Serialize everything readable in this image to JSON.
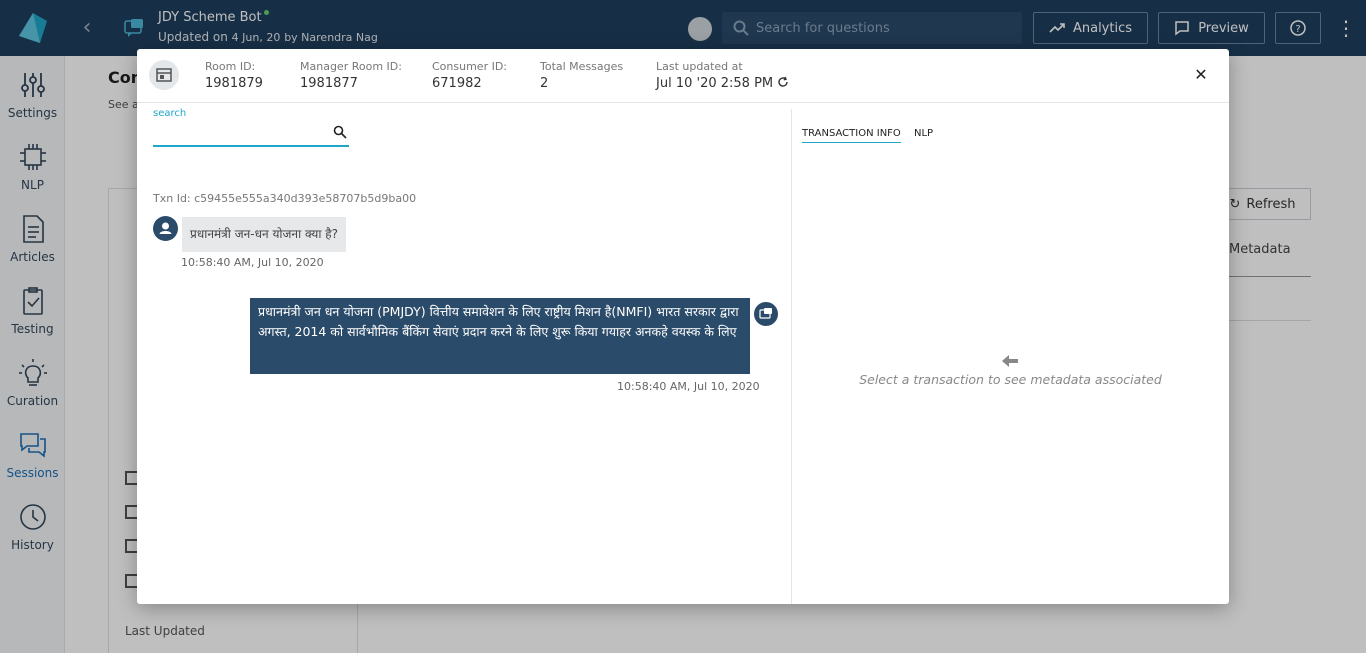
{
  "app": {
    "bot_name": "JDY Scheme Bot",
    "updated_prefix": "Updated on",
    "updated_date": "4 Jun, 20",
    "updated_by": "by Narendra Nag",
    "search_placeholder": "Search for questions",
    "analytics_label": "Analytics",
    "preview_label": "Preview",
    "accent": "#1fa7c9",
    "header_bg": "#1f3f5e"
  },
  "sidebar": {
    "items": [
      {
        "label": "Settings",
        "icon": "sliders-icon"
      },
      {
        "label": "NLP",
        "icon": "chip-icon"
      },
      {
        "label": "Articles",
        "icon": "document-icon"
      },
      {
        "label": "Testing",
        "icon": "clipboard-check-icon"
      },
      {
        "label": "Curation",
        "icon": "lightbulb-icon"
      },
      {
        "label": "Sessions",
        "icon": "chat-icon",
        "active": true
      },
      {
        "label": "History",
        "icon": "clock-icon"
      }
    ]
  },
  "background": {
    "heading": "Con",
    "subtext": "See al",
    "refresh_label": "Refresh",
    "metadata_label": "Metadata",
    "last_updated_label": "Last Updated"
  },
  "modal": {
    "room_id_label": "Room ID:",
    "room_id": "1981879",
    "manager_room_id_label": "Manager Room ID:",
    "manager_room_id": "1981877",
    "consumer_id_label": "Consumer ID:",
    "consumer_id": "671982",
    "total_messages_label": "Total Messages",
    "total_messages": "2",
    "last_updated_label": "Last updated at",
    "last_updated": "Jul 10 '20 2:58 PM",
    "search_label": "search",
    "search_value": "",
    "txn_id": "Txn Id: c59455e555a340d393e58707b5d9ba00",
    "user_message": "प्रधानमंत्री जन-धन योजना क्या है?",
    "user_time": "10:58:40 AM, Jul 10, 2020",
    "bot_message": "प्रधानमंत्री जन धन योजना (PMJDY) वित्तीय समावेशन के लिए राष्ट्रीय मिशन है(NMFI) भारत सरकार द्वारा अगस्त, 2014 को सार्वभौमिक बैंकिंग सेवाएं प्रदान करने के लिए शुरू किया गयाहर अनकहे वयस्क के लिए",
    "bot_time": "10:58:40 AM, Jul 10, 2020",
    "tabs": [
      "TRANSACTION INFO",
      "NLP"
    ],
    "empty_message": "Select a transaction to see metadata associated"
  }
}
